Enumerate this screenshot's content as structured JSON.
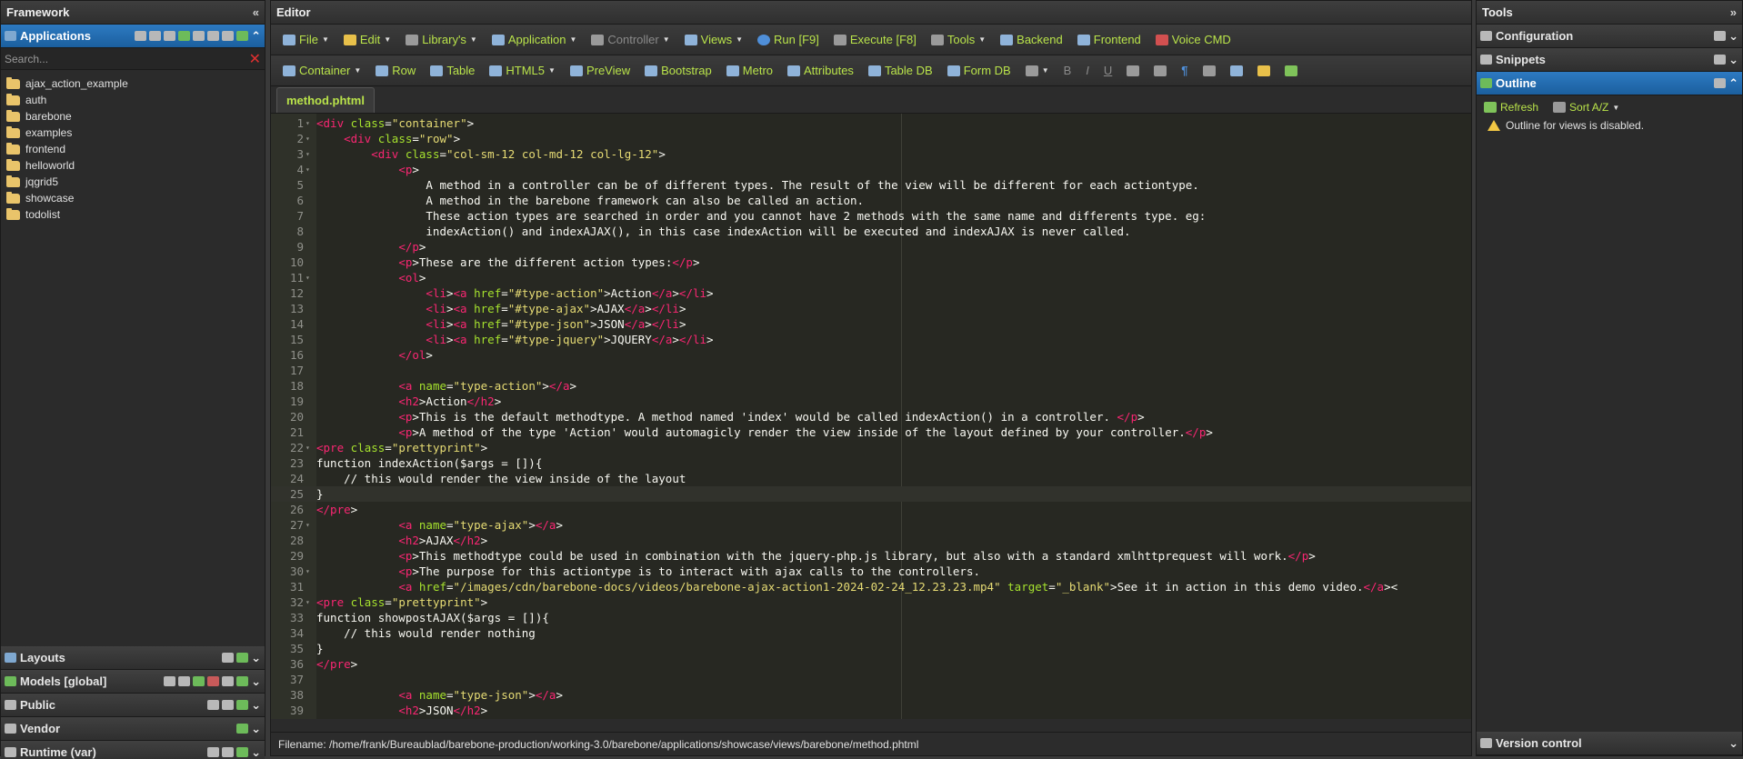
{
  "left": {
    "title": "Framework",
    "applications": {
      "label": "Applications",
      "search_placeholder": "Search...",
      "items": [
        "ajax_action_example",
        "auth",
        "barebone",
        "examples",
        "frontend",
        "helloworld",
        "jqgrid5",
        "showcase",
        "todolist"
      ]
    },
    "sections": [
      "Layouts",
      "Models [global]",
      "Public",
      "Vendor",
      "Runtime (var)"
    ]
  },
  "editor": {
    "title": "Editor",
    "toolbar1": [
      "File",
      "Edit",
      "Library's",
      "Application",
      "Controller",
      "Views",
      "Run [F9]",
      "Execute [F8]",
      "Tools",
      "Backend",
      "Frontend",
      "Voice CMD"
    ],
    "toolbar2": [
      "Container",
      "Row",
      "Table",
      "HTML5",
      "PreView",
      "Bootstrap",
      "Metro",
      "Attributes",
      "Table DB",
      "Form DB"
    ],
    "tab": "method.phtml",
    "filename": "Filename: /home/frank/Bureaublad/barebone-production/working-3.0/barebone/applications/showcase/views/barebone/method.phtml",
    "lines": [
      "<div class=\"container\">",
      "    <div class=\"row\">",
      "        <div class=\"col-sm-12 col-md-12 col-lg-12\">",
      "            <p>",
      "                A method in a controller can be of different types. The result of the view will be different for each actiontype.",
      "                A method in the barebone framework can also be called an action.",
      "                These action types are searched in order and you cannot have 2 methods with the same name and differents type. eg:",
      "                indexAction() and indexAJAX(), in this case indexAction will be executed and indexAJAX is never called.",
      "            </p>",
      "            <p>These are the different action types:</p>",
      "            <ol>",
      "                <li><a href=\"#type-action\">Action</a></li>",
      "                <li><a href=\"#type-ajax\">AJAX</a></li>",
      "                <li><a href=\"#type-json\">JSON</a></li>",
      "                <li><a href=\"#type-jquery\">JQUERY</a></li>",
      "            </ol>",
      "",
      "            <a name=\"type-action\"></a>",
      "            <h2>Action</h2>",
      "            <p>This is the default methodtype. A method named 'index' would be called indexAction() in a controller. </p>",
      "            <p>A method of the type 'Action' would automagicly render the view inside of the layout defined by your controller.</p>",
      "<pre class=\"prettyprint\">",
      "function indexAction($args = []){",
      "    // this would render the view inside of the layout",
      "}",
      "</pre>",
      "            <a name=\"type-ajax\"></a>",
      "            <h2>AJAX</h2>",
      "            <p>This methodtype could be used in combination with the jquery-php.js library, but also with a standard xmlhttprequest will work.</p>",
      "            <p>The purpose for this actiontype is to interact with ajax calls to the controllers.",
      "            <a href=\"/images/cdn/barebone-docs/videos/barebone-ajax-action1-2024-02-24_12.23.23.mp4\" target=\"_blank\">See it in action in this demo video.</a><",
      "<pre class=\"prettyprint\">",
      "function showpostAJAX($args = []){",
      "    // this would render nothing",
      "}",
      "</pre>",
      "",
      "            <a name=\"type-json\"></a>",
      "            <h2>JSON</h2>"
    ]
  },
  "right": {
    "title": "Tools",
    "configuration": "Configuration",
    "snippets": "Snippets",
    "outline": "Outline",
    "refresh": "Refresh",
    "sort": "Sort A/Z",
    "notice": "Outline for views is disabled.",
    "version_control": "Version control"
  },
  "icons": {
    "collapse": "chevrons-left-icon",
    "expand": "chevrons-right-icon",
    "folder": "folder-icon",
    "warning": "warning-icon"
  },
  "colors": {
    "accent_blue": "#1b5f9e",
    "toolbar_text": "#b9e34a",
    "editor_bg": "#272822"
  }
}
